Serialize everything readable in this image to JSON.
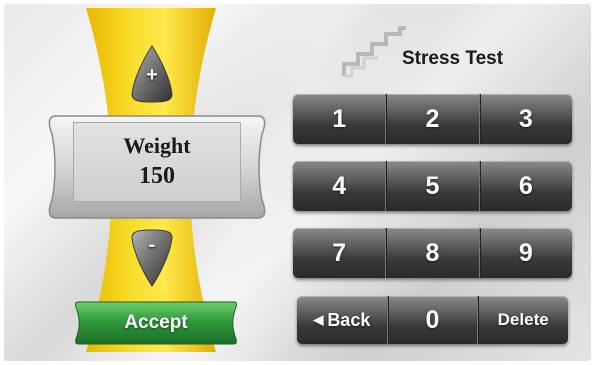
{
  "header": {
    "title": "Stress Test"
  },
  "weight": {
    "label": "Weight",
    "value": "150",
    "increase_symbol": "+",
    "decrease_symbol": "-"
  },
  "actions": {
    "accept_label": "Accept"
  },
  "keypad": {
    "row1": [
      "1",
      "2",
      "3"
    ],
    "row2": [
      "4",
      "5",
      "6"
    ],
    "row3": [
      "7",
      "8",
      "9"
    ],
    "back_label": "Back",
    "back_icon": "left-triangle-icon",
    "zero_label": "0",
    "delete_label": "Delete"
  },
  "colors": {
    "yellow_band": "#f2cf0a",
    "accept_green": "#2f9a3c",
    "key_dark": "#3a3a3a",
    "stairs_gray": "#b8b8b8"
  }
}
